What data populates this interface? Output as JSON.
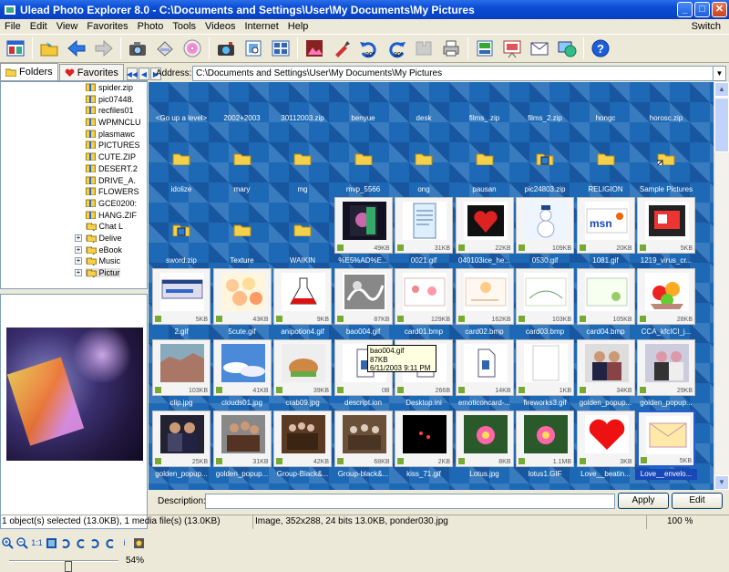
{
  "window": {
    "title": "Ulead Photo Explorer 8.0 - C:\\Documents and Settings\\User\\My Documents\\My Pictures",
    "minimize": "_",
    "maximize": "□",
    "close": "✕"
  },
  "menu": {
    "items": [
      "File",
      "Edit",
      "View",
      "Favorites",
      "Photo",
      "Tools",
      "Videos",
      "Internet",
      "Help"
    ],
    "switch_label": "Switch"
  },
  "toolbar": {
    "rotate_left_label": "90°",
    "rotate_right_label": "90°"
  },
  "left_panel": {
    "tabs": [
      {
        "label": "Folders"
      },
      {
        "label": "Favorites"
      }
    ],
    "tree": [
      {
        "label": "spider.zip",
        "type": "zip"
      },
      {
        "label": "pic07448.",
        "type": "zip"
      },
      {
        "label": "recfiles01",
        "type": "zip"
      },
      {
        "label": "WPMNCLU",
        "type": "zip"
      },
      {
        "label": "plasmawc",
        "type": "zip"
      },
      {
        "label": "PICTURES",
        "type": "zip"
      },
      {
        "label": "CUTE.ZIP",
        "type": "zip"
      },
      {
        "label": "DESERT.2",
        "type": "zip"
      },
      {
        "label": "DRIVE_A.",
        "type": "zip"
      },
      {
        "label": "FLOWERS",
        "type": "zip"
      },
      {
        "label": "GCE0200:",
        "type": "zip"
      },
      {
        "label": "HANG.ZIF",
        "type": "zip"
      },
      {
        "label": "My Chat L",
        "type": "folder",
        "expander": ""
      },
      {
        "label": "My Delive",
        "type": "folder",
        "expander": "+"
      },
      {
        "label": "My eBook",
        "type": "folder",
        "expander": "+"
      },
      {
        "label": "My Music",
        "type": "folder",
        "expander": "+"
      },
      {
        "label": "My Pictur",
        "type": "folder",
        "expander": "+",
        "selected": true
      }
    ],
    "preview_tools": {
      "one_to_one": "1:1",
      "info": "i"
    },
    "zoom": {
      "value_label": "54%",
      "fraction": 0.54
    }
  },
  "address": {
    "label": "Address:",
    "value": "C:\\Documents and Settings\\User\\My Documents\\My Pictures"
  },
  "items": [
    {
      "label": "<Go up a level>",
      "kind": "top"
    },
    {
      "label": "2002+2003",
      "kind": "top"
    },
    {
      "label": "30112003.zip",
      "kind": "top"
    },
    {
      "label": "benyue",
      "kind": "top"
    },
    {
      "label": "desk",
      "kind": "top"
    },
    {
      "label": "films_.zip",
      "kind": "top"
    },
    {
      "label": "films_2.zip",
      "kind": "top"
    },
    {
      "label": "hongc",
      "kind": "top"
    },
    {
      "label": "horosc.zip",
      "kind": "top"
    },
    {
      "label": "idolize",
      "kind": "folder"
    },
    {
      "label": "mary",
      "kind": "folder"
    },
    {
      "label": "mg",
      "kind": "folder"
    },
    {
      "label": "mvp_5566",
      "kind": "folder"
    },
    {
      "label": "ong",
      "kind": "folder"
    },
    {
      "label": "pausan",
      "kind": "folder"
    },
    {
      "label": "pic24803.zip",
      "kind": "zipfolder"
    },
    {
      "label": "RELIGION",
      "kind": "folder"
    },
    {
      "label": "Sample Pictures",
      "kind": "shortcut"
    },
    {
      "label": "sword.zip",
      "kind": "zipfolder"
    },
    {
      "label": "Texture",
      "kind": "folder"
    },
    {
      "label": "WAIKIN",
      "kind": "folder"
    },
    {
      "label": "%E5%AD%E...",
      "kind": "thumb",
      "size": "49KB",
      "art": "dark"
    },
    {
      "label": "0021.gif",
      "kind": "thumb",
      "size": "31KB",
      "art": "paper"
    },
    {
      "label": "040103ice_he...",
      "kind": "thumb",
      "size": "22KB",
      "art": "heart"
    },
    {
      "label": "0530.gif",
      "kind": "thumb",
      "size": "109KB",
      "art": "snowman"
    },
    {
      "label": "1081.gif",
      "kind": "thumb",
      "size": "20KB",
      "art": "msn"
    },
    {
      "label": "1219_virus_cr...",
      "kind": "thumb",
      "size": "5KB",
      "art": "virus"
    },
    {
      "label": "2.gif",
      "kind": "thumb",
      "size": "5KB",
      "art": "window"
    },
    {
      "label": "5cute.gif",
      "kind": "thumb",
      "size": "43KB",
      "art": "cute"
    },
    {
      "label": "anipotion4.gif",
      "kind": "thumb",
      "size": "9KB",
      "art": "potion"
    },
    {
      "label": "bao004.gif",
      "kind": "thumb",
      "size": "87KB",
      "art": "bw"
    },
    {
      "label": "card01.bmp",
      "kind": "thumb",
      "size": "129KB",
      "art": "card"
    },
    {
      "label": "card02.bmp",
      "kind": "thumb",
      "size": "162KB",
      "art": "card2"
    },
    {
      "label": "card03.bmp",
      "kind": "thumb",
      "size": "103KB",
      "art": "card3"
    },
    {
      "label": "card04.bmp",
      "kind": "thumb",
      "size": "105KB",
      "art": "card4"
    },
    {
      "label": "CCA_kfcICI_j...",
      "kind": "thumb",
      "size": "28KB",
      "art": "fruit"
    },
    {
      "label": "clip.jpg",
      "kind": "thumb",
      "size": "103KB",
      "art": "rocks"
    },
    {
      "label": "clouds01.jpg",
      "kind": "thumb",
      "size": "41KB",
      "art": "clouds"
    },
    {
      "label": "crab09.jpg",
      "kind": "thumb",
      "size": "39KB",
      "art": "crab"
    },
    {
      "label": "descript.ion",
      "kind": "doc",
      "size": "0B"
    },
    {
      "label": "Desktop.ini",
      "kind": "doc",
      "size": "266B"
    },
    {
      "label": "emoticoncard-...",
      "kind": "doc",
      "size": "14KB"
    },
    {
      "label": "fireworks3.gif",
      "kind": "thumb",
      "size": "1KB",
      "art": "white"
    },
    {
      "label": "golden_popup...",
      "kind": "thumb",
      "size": "34KB",
      "art": "people"
    },
    {
      "label": "golden_popup...",
      "kind": "thumb",
      "size": "29KB",
      "art": "people2"
    },
    {
      "label": "golden_popup...",
      "kind": "thumb",
      "size": "25KB",
      "art": "people3"
    },
    {
      "label": "golden_popup...",
      "kind": "thumb",
      "size": "31KB",
      "art": "people4"
    },
    {
      "label": "Group-Black&...",
      "kind": "thumb",
      "size": "42KB",
      "art": "group"
    },
    {
      "label": "Group-black&...",
      "kind": "thumb",
      "size": "68KB",
      "art": "group2"
    },
    {
      "label": "kiss_71.gif",
      "kind": "thumb",
      "size": "2KB",
      "art": "black"
    },
    {
      "label": "Lotus.jpg",
      "kind": "thumb",
      "size": "8KB",
      "art": "lotus"
    },
    {
      "label": "lotus1.GIF",
      "kind": "thumb",
      "size": "1.1MB",
      "art": "lotus"
    },
    {
      "label": "Love__beatin...",
      "kind": "thumb",
      "size": "3KB",
      "art": "bigheart"
    },
    {
      "label": "Love__envelo...",
      "kind": "thumb",
      "size": "5KB",
      "art": "envelope",
      "selected": true
    }
  ],
  "tooltip": {
    "name": "bao004.gif",
    "size": "87KB",
    "date": "6/11/2003 9:11 PM"
  },
  "description": {
    "label": "Description:",
    "apply": "Apply",
    "edit": "Edit"
  },
  "status": {
    "selection": "1 object(s) selected (13.0KB), 1 media file(s) (13.0KB)",
    "image_info": "Image, 352x288, 24 bits 13.0KB, ponder030.jpg",
    "zoom": "100 %"
  },
  "colors": {
    "titlebar": "#0a4dd4",
    "browser_bg": "#1d69b5",
    "selection": "#1848b8",
    "folder": "#f5d04a"
  }
}
